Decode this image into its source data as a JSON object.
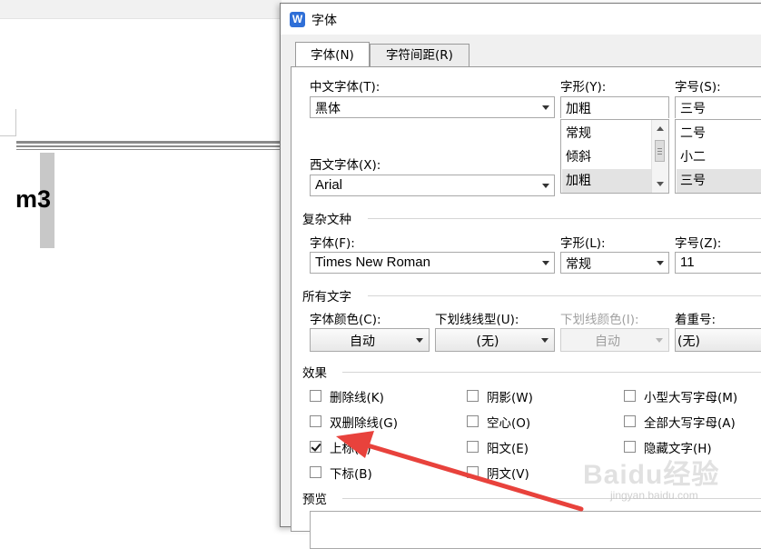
{
  "document": {
    "text": "m3"
  },
  "dialog": {
    "title": "字体",
    "app_icon": "W",
    "tabs": [
      {
        "label": "字体(N)",
        "active": true
      },
      {
        "label": "字符间距(R)",
        "active": false
      }
    ],
    "chinese_font": {
      "label": "中文字体(T):",
      "value": "黑体"
    },
    "western_font": {
      "label": "西文字体(X):",
      "value": "Arial"
    },
    "style": {
      "label": "字形(Y):",
      "value": "加粗",
      "options": [
        "常规",
        "倾斜",
        "加粗"
      ],
      "selected": "加粗"
    },
    "size": {
      "label": "字号(S):",
      "value": "三号",
      "options": [
        "二号",
        "小二",
        "三号"
      ],
      "selected": "三号"
    },
    "complex": {
      "group_label": "复杂文种",
      "font_label": "字体(F):",
      "font_value": "Times New Roman",
      "style_label": "字形(L):",
      "style_value": "常规",
      "size_label": "字号(Z):",
      "size_value": "11"
    },
    "all_text": {
      "group_label": "所有文字",
      "color_label": "字体颜色(C):",
      "color_value": "自动",
      "underline_label": "下划线线型(U):",
      "underline_value": "(无)",
      "underline_color_label": "下划线颜色(I):",
      "underline_color_value": "自动",
      "emphasis_label": "着重号:",
      "emphasis_value": "(无)"
    },
    "effects": {
      "group_label": "效果",
      "items": [
        {
          "label": "删除线(K)",
          "checked": false
        },
        {
          "label": "阴影(W)",
          "checked": false
        },
        {
          "label": "小型大写字母(M)",
          "checked": false
        },
        {
          "label": "双删除线(G)",
          "checked": false
        },
        {
          "label": "空心(O)",
          "checked": false
        },
        {
          "label": "全部大写字母(A)",
          "checked": false
        },
        {
          "label": "上标(P)",
          "checked": true
        },
        {
          "label": "阳文(E)",
          "checked": false
        },
        {
          "label": "隐藏文字(H)",
          "checked": false
        },
        {
          "label": "下标(B)",
          "checked": false
        },
        {
          "label": "阴文(V)",
          "checked": false
        }
      ]
    },
    "preview": {
      "group_label": "预览"
    }
  },
  "watermark": {
    "text": "Baidu经验",
    "sub": "jingyan.baidu.com"
  },
  "colors": {
    "annotation_arrow": "#e8423c",
    "window_bg": "#f0f0f0",
    "app_icon": "#2f6fd7"
  },
  "icons": [
    "wps-app-icon",
    "dropdown-arrow-icon",
    "scroll-up-icon",
    "scroll-down-icon",
    "checkmark-icon",
    "annotation-arrow-icon"
  ]
}
